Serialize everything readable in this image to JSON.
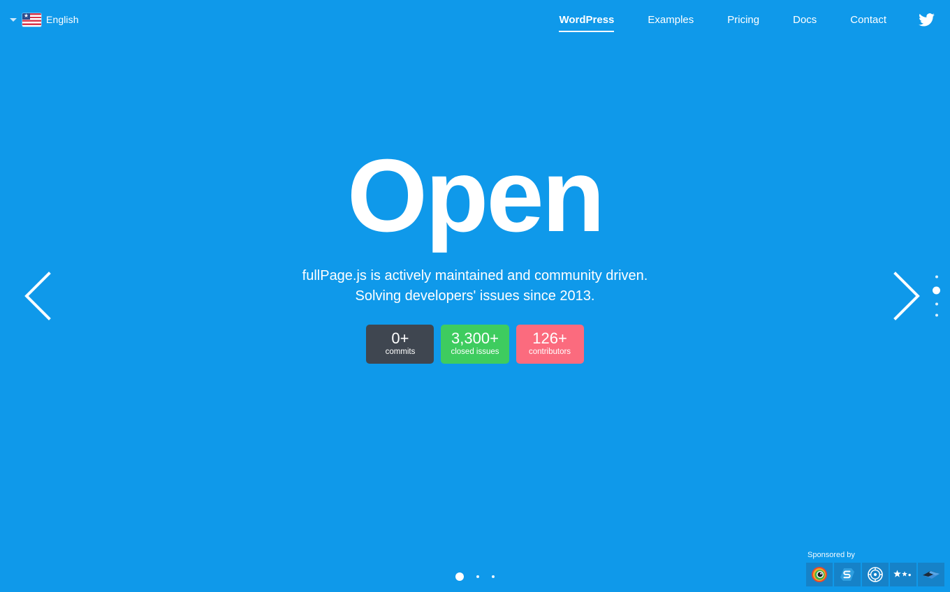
{
  "page": {
    "background_color": "#0f99ea"
  },
  "topbar": {
    "language": {
      "label": "English",
      "caret_icon": "chevron-down-icon",
      "flag_icon": "flag-icon"
    },
    "nav": [
      {
        "label": "WordPress",
        "active": true
      },
      {
        "label": "Examples",
        "active": false
      },
      {
        "label": "Pricing",
        "active": false
      },
      {
        "label": "Docs",
        "active": false
      },
      {
        "label": "Contact",
        "active": false
      }
    ],
    "social": {
      "twitter_icon": "twitter-icon"
    }
  },
  "hero": {
    "headline": "Open",
    "subtitle_line1": "fullPage.js is actively maintained and community driven.",
    "subtitle_line2": "Solving developers' issues since 2013.",
    "badges": [
      {
        "value": "0+",
        "label": "commits",
        "color": "#3f4650"
      },
      {
        "value": "3,300+",
        "label": "closed issues",
        "color": "#3ecc5f"
      },
      {
        "value": "126+",
        "label": "contributors",
        "color": "#fb6b7e"
      }
    ]
  },
  "navigation": {
    "prev_arrow_icon": "chevron-left-icon",
    "next_arrow_icon": "chevron-right-icon",
    "vertical_dots": [
      {
        "active": false
      },
      {
        "active": true
      },
      {
        "active": false
      },
      {
        "active": false
      }
    ],
    "slide_dots": [
      {
        "active": true
      },
      {
        "active": false
      },
      {
        "active": false
      }
    ]
  },
  "sponsors": {
    "label": "Sponsored by",
    "items": [
      {
        "name": "eye-spiral-logo-icon"
      },
      {
        "name": "hexagon-s-logo-icon"
      },
      {
        "name": "circle-target-logo-icon"
      },
      {
        "name": "stars-logo-icon"
      },
      {
        "name": "arrow-diamond-logo-icon"
      }
    ]
  }
}
